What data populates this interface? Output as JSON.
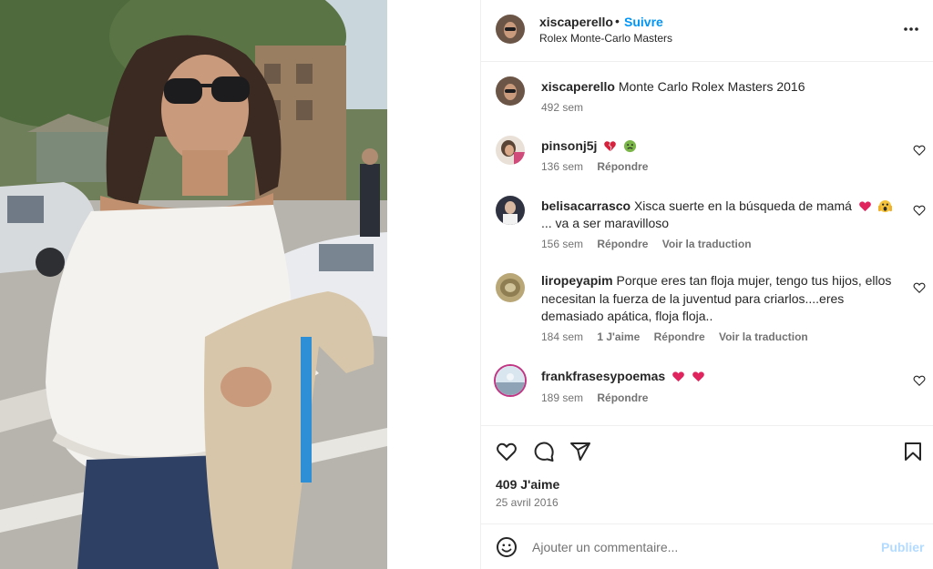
{
  "post": {
    "author": "xiscaperello",
    "separator": "•",
    "follow_label": "Suivre",
    "location": "Rolex Monte-Carlo Masters",
    "caption": "Monte Carlo Rolex Masters 2016",
    "caption_time": "492 sem",
    "likes": "409 J'aime",
    "date": "25 avril 2016"
  },
  "comments": [
    {
      "user": "pinsonj5j",
      "text": "",
      "emojis": [
        "broken-heart-icon",
        "nauseated-face-icon"
      ],
      "time": "136 sem",
      "likes": "",
      "reply": "Répondre",
      "translate": ""
    },
    {
      "user": "belisacarrasco",
      "text": "Xisca suerte en la búsqueda de mamá",
      "emojis": [
        "red-heart-icon",
        "face-screaming-icon"
      ],
      "text_after": "... va a ser maravilloso",
      "time": "156 sem",
      "likes": "",
      "reply": "Répondre",
      "translate": "Voir la traduction"
    },
    {
      "user": "liropeyapim",
      "text": "Porque eres tan floja mujer, tengo tus hijos, ellos necesitan la fuerza de la juventud para criarlos....eres demasiado apática, floja floja..",
      "emojis": [],
      "time": "184 sem",
      "likes": "1 J'aime",
      "reply": "Répondre",
      "translate": "Voir la traduction"
    },
    {
      "user": "frankfrasesypoemas",
      "text": "",
      "emojis": [
        "red-heart-icon",
        "red-heart-icon"
      ],
      "time": "189 sem",
      "likes": "",
      "reply": "Répondre",
      "translate": ""
    }
  ],
  "composer": {
    "placeholder": "Ajouter un commentaire...",
    "publish_label": "Publier"
  },
  "icons": {
    "more": "more-options-icon",
    "like": "heart-icon",
    "comment": "comment-icon",
    "share": "share-icon",
    "save": "bookmark-icon",
    "emoji": "emoji-icon"
  },
  "colors": {
    "link": "#0095f6",
    "publish_disabled": "#b3dbff",
    "heart_red": "#e0245e"
  }
}
